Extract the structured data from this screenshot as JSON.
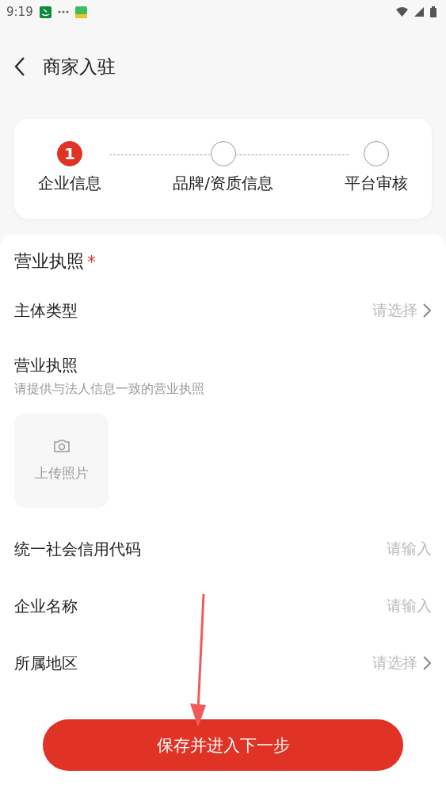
{
  "status_bar": {
    "time": "9:19"
  },
  "header": {
    "title": "商家入驻"
  },
  "steps": [
    {
      "label": "企业信息",
      "number": "1",
      "active": true
    },
    {
      "label": "品牌/资质信息",
      "active": false
    },
    {
      "label": "平台审核",
      "active": false
    }
  ],
  "form": {
    "section_title": "营业执照",
    "required_mark": "*",
    "rows": [
      {
        "kind": "select",
        "label": "主体类型",
        "placeholder": "请选择"
      },
      {
        "kind": "upload",
        "label": "营业执照",
        "hint": "请提供与法人信息一致的营业执照",
        "button": "上传照片"
      },
      {
        "kind": "input",
        "label": "统一社会信用代码",
        "placeholder": "请输入"
      },
      {
        "kind": "input",
        "label": "企业名称",
        "placeholder": "请输入"
      },
      {
        "kind": "select",
        "label": "所属地区",
        "placeholder": "请选择"
      }
    ]
  },
  "submit": {
    "label": "保存并进入下一步"
  }
}
